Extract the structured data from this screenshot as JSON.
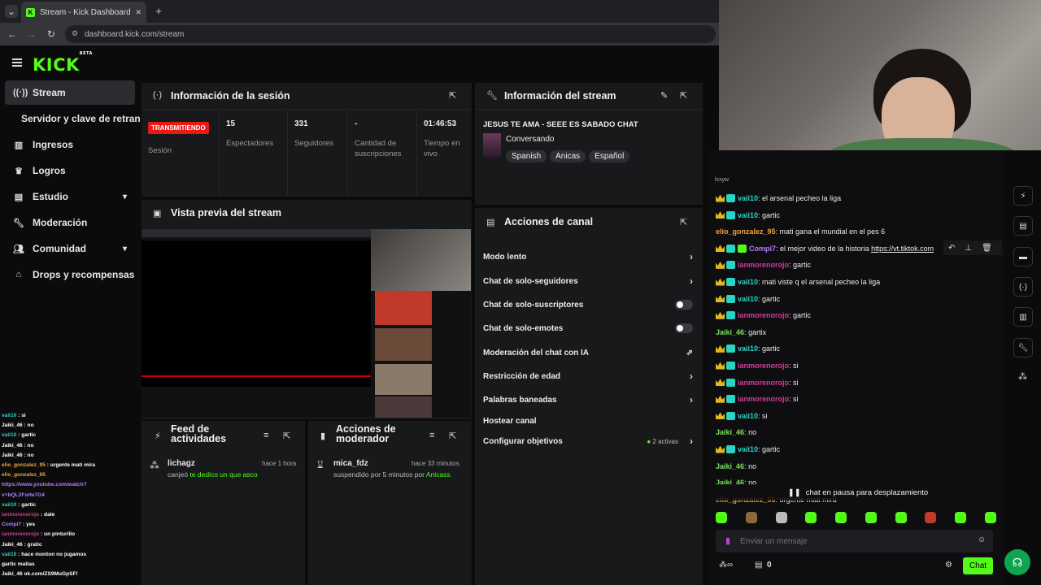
{
  "browser": {
    "tab_title": "Stream - Kick Dashboard",
    "tab_close": "✕",
    "new_tab": "+",
    "url": "dashboard.kick.com/stream"
  },
  "app": {
    "logo": "KICK",
    "logo_badge": "BETA"
  },
  "sidebar": {
    "items": [
      {
        "label": "Stream",
        "icon": "broadcast-icon"
      },
      {
        "label": "Servidor y clave de retransm",
        "icon": ""
      },
      {
        "label": "Ingresos",
        "icon": "bar-chart-icon"
      },
      {
        "label": "Logros",
        "icon": "trophy-icon"
      },
      {
        "label": "Estudio",
        "icon": "layout-icon"
      },
      {
        "label": "Moderación",
        "icon": "wrench-icon"
      },
      {
        "label": "Comunidad",
        "icon": "people-icon"
      },
      {
        "label": "Drops y recompensas",
        "icon": "gift-icon"
      }
    ]
  },
  "session": {
    "title": "Información de la sesión",
    "status": "TRANSMITIENDO",
    "status_label": "Sesión",
    "stats": [
      {
        "value": "15",
        "label": "Espectadores"
      },
      {
        "value": "331",
        "label": "Seguidores"
      },
      {
        "value": "-",
        "label": "Cantidad de suscripciones"
      },
      {
        "value": "01:46:53",
        "label": "Tiempo en vivo"
      }
    ]
  },
  "stream_info": {
    "title": "Información del stream",
    "stream_title": "JESUS TE AMA - SEEE ES SABADO CHAT",
    "category": "Conversando",
    "tags": [
      "Spanish",
      "Anicas",
      "Español"
    ]
  },
  "preview": {
    "title": "Vista previa del stream"
  },
  "channel_actions": {
    "title": "Acciones de canal",
    "items": [
      {
        "label": "Modo lento",
        "control": "chevron"
      },
      {
        "label": "Chat de solo-seguidores",
        "control": "chevron"
      },
      {
        "label": "Chat de solo-suscriptores",
        "control": "toggle"
      },
      {
        "label": "Chat de solo-emotes",
        "control": "toggle"
      },
      {
        "label": "Moderación del chat con IA",
        "control": "external"
      },
      {
        "label": "Restricción de edad",
        "control": "chevron"
      },
      {
        "label": "Palabras baneadas",
        "control": "chevron"
      },
      {
        "label": "Hostear canal",
        "control": "none"
      },
      {
        "label": "Configurar objetivos",
        "control": "chevron"
      }
    ],
    "objectives_active": "2 activas"
  },
  "activity": {
    "title": "Feed de actividades",
    "user": "lichagz",
    "time": "hace 1 hora",
    "text_prefix": "canjeó",
    "text_highlight": "te dedico un que asco"
  },
  "mod_actions": {
    "title": "Acciones de moderador",
    "user": "mica_fdz",
    "time": "hace 33 minutos",
    "text_prefix": "suspendido por 5 minutos por",
    "text_highlight": "Anicass"
  },
  "left_chat": [
    {
      "user": "vaii10",
      "text": "si",
      "color": "#2bd3c5"
    },
    {
      "user": "Jaiki_46",
      "text": "no",
      "color": "#ffffff"
    },
    {
      "user": "vaii10",
      "text": "gartic",
      "color": "#2bd3c5"
    },
    {
      "user": "Jaiki_46",
      "text": "no",
      "color": "#ffffff"
    },
    {
      "user": "Jaiki_46",
      "text": "no",
      "color": "#ffffff"
    },
    {
      "user": "elio_gonzalez_95",
      "text": "urgente mati mira",
      "color": "#f2a33a"
    },
    {
      "user": "elio_gonzalez_95",
      "text": "",
      "color": "#f2a33a"
    },
    {
      "user": "",
      "text": "https://www.youtube.com/watch?",
      "color": "#b57bff"
    },
    {
      "user": "",
      "text": "v=bQL2FsHe7G4",
      "color": "#b57bff"
    },
    {
      "user": "vaii10",
      "text": "gartic",
      "color": "#2bd3c5"
    },
    {
      "user": "ianmorenorojo",
      "text": "dale",
      "color": "#d63a9a"
    },
    {
      "user": "Compi7",
      "text": "yes",
      "color": "#b57bff"
    },
    {
      "user": "ianmorenorojo",
      "text": "un pinturillo",
      "color": "#d63a9a"
    },
    {
      "user": "Jaiki_46",
      "text": "gratic",
      "color": "#ffffff"
    },
    {
      "user": "vaii10",
      "text": "hace monton no jugamos",
      "color": "#2bd3c5"
    },
    {
      "user": "",
      "text": "gartic matias",
      "color": "#ffffff"
    },
    {
      "user": "",
      "text": "Jaiki_46 ok.com/ZS9MuGpSF/",
      "color": "#ffffff"
    }
  ],
  "chat": {
    "top_fragment": "lxxyw",
    "messages": [
      {
        "user": "vaii10",
        "text": "el arsenal pecheo la liga",
        "color": "#2bd3c5",
        "badges": [
          "crown",
          "bdg"
        ]
      },
      {
        "user": "vaii10",
        "text": "gartic",
        "color": "#2bd3c5",
        "badges": [
          "crown",
          "bdg"
        ]
      },
      {
        "user": "elio_gonzalez_95",
        "text": "mati gana el mundial en el pes 6",
        "color": "#f2a33a",
        "badges": []
      },
      {
        "user": "Compi7",
        "text": "el mejor video de la historia",
        "link": "https://vt.tiktok.com",
        "color": "#b57bff",
        "badges": [
          "crown",
          "bdg",
          "green"
        ]
      },
      {
        "user": "ianmorenorojo",
        "text": "gartic",
        "color": "#d63a9a",
        "badges": [
          "crown",
          "bdg"
        ]
      },
      {
        "user": "vaii10",
        "text": "mati viste q el arsenal pecheo la liga",
        "color": "#2bd3c5",
        "badges": [
          "crown",
          "bdg"
        ]
      },
      {
        "user": "vaii10",
        "text": "gartic",
        "color": "#2bd3c5",
        "badges": [
          "crown",
          "bdg"
        ]
      },
      {
        "user": "ianmorenorojo",
        "text": "gartic",
        "color": "#d63a9a",
        "badges": [
          "crown",
          "bdg"
        ]
      },
      {
        "user": "Jaiki_46",
        "text": "gartix",
        "color": "#7ee05a",
        "badges": []
      },
      {
        "user": "vaii10",
        "text": "gartic",
        "color": "#2bd3c5",
        "badges": [
          "crown",
          "bdg"
        ]
      },
      {
        "user": "ianmorenorojo",
        "text": "si",
        "color": "#d63a9a",
        "badges": [
          "crown",
          "bdg"
        ]
      },
      {
        "user": "ianmorenorojo",
        "text": "si",
        "color": "#d63a9a",
        "badges": [
          "crown",
          "bdg"
        ]
      },
      {
        "user": "ianmorenorojo",
        "text": "si",
        "color": "#d63a9a",
        "badges": [
          "crown",
          "bdg"
        ]
      },
      {
        "user": "vaii10",
        "text": "si",
        "color": "#2bd3c5",
        "badges": [
          "crown",
          "bdg"
        ]
      },
      {
        "user": "Jaiki_46",
        "text": "no",
        "color": "#7ee05a",
        "badges": []
      },
      {
        "user": "vaii10",
        "text": "gartic",
        "color": "#2bd3c5",
        "badges": [
          "crown",
          "bdg"
        ]
      },
      {
        "user": "Jaiki_46",
        "text": "no",
        "color": "#7ee05a",
        "badges": []
      },
      {
        "user": "Jaiki_46",
        "text": "no",
        "color": "#7ee05a",
        "badges": []
      },
      {
        "user": "elio_gonzalez_95",
        "text": "urgente mati mira",
        "color": "#f2a33a",
        "badges": []
      }
    ],
    "paused": "chat en pausa para desplazamiento",
    "input_placeholder": "Enviar un mensaje",
    "points": "0",
    "send_label": "Chat"
  },
  "colors": {
    "accent": "#53fc18",
    "live": "#e91916"
  }
}
